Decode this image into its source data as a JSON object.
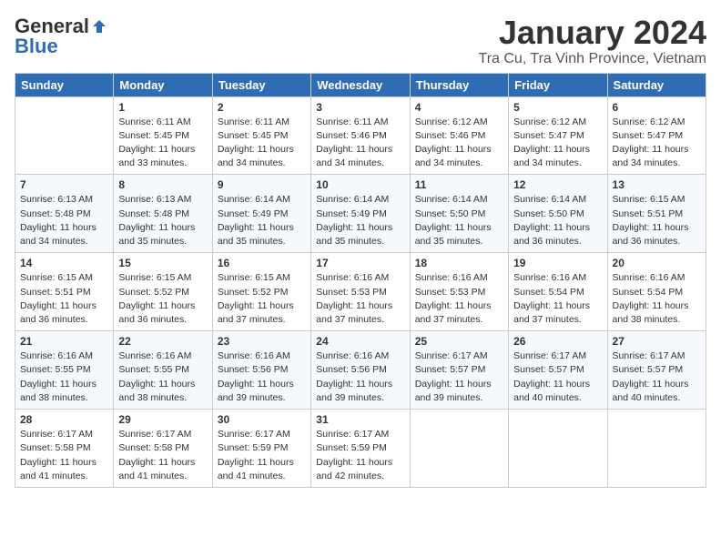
{
  "header": {
    "logo_general": "General",
    "logo_blue": "Blue",
    "title": "January 2024",
    "subtitle": "Tra Cu, Tra Vinh Province, Vietnam"
  },
  "days_of_week": [
    "Sunday",
    "Monday",
    "Tuesday",
    "Wednesday",
    "Thursday",
    "Friday",
    "Saturday"
  ],
  "weeks": [
    [
      {
        "day": "",
        "sunrise": "",
        "sunset": "",
        "daylight": ""
      },
      {
        "day": "1",
        "sunrise": "6:11 AM",
        "sunset": "5:45 PM",
        "daylight": "11 hours and 33 minutes."
      },
      {
        "day": "2",
        "sunrise": "6:11 AM",
        "sunset": "5:45 PM",
        "daylight": "11 hours and 34 minutes."
      },
      {
        "day": "3",
        "sunrise": "6:11 AM",
        "sunset": "5:46 PM",
        "daylight": "11 hours and 34 minutes."
      },
      {
        "day": "4",
        "sunrise": "6:12 AM",
        "sunset": "5:46 PM",
        "daylight": "11 hours and 34 minutes."
      },
      {
        "day": "5",
        "sunrise": "6:12 AM",
        "sunset": "5:47 PM",
        "daylight": "11 hours and 34 minutes."
      },
      {
        "day": "6",
        "sunrise": "6:12 AM",
        "sunset": "5:47 PM",
        "daylight": "11 hours and 34 minutes."
      }
    ],
    [
      {
        "day": "7",
        "sunrise": "6:13 AM",
        "sunset": "5:48 PM",
        "daylight": "11 hours and 34 minutes."
      },
      {
        "day": "8",
        "sunrise": "6:13 AM",
        "sunset": "5:48 PM",
        "daylight": "11 hours and 35 minutes."
      },
      {
        "day": "9",
        "sunrise": "6:14 AM",
        "sunset": "5:49 PM",
        "daylight": "11 hours and 35 minutes."
      },
      {
        "day": "10",
        "sunrise": "6:14 AM",
        "sunset": "5:49 PM",
        "daylight": "11 hours and 35 minutes."
      },
      {
        "day": "11",
        "sunrise": "6:14 AM",
        "sunset": "5:50 PM",
        "daylight": "11 hours and 35 minutes."
      },
      {
        "day": "12",
        "sunrise": "6:14 AM",
        "sunset": "5:50 PM",
        "daylight": "11 hours and 36 minutes."
      },
      {
        "day": "13",
        "sunrise": "6:15 AM",
        "sunset": "5:51 PM",
        "daylight": "11 hours and 36 minutes."
      }
    ],
    [
      {
        "day": "14",
        "sunrise": "6:15 AM",
        "sunset": "5:51 PM",
        "daylight": "11 hours and 36 minutes."
      },
      {
        "day": "15",
        "sunrise": "6:15 AM",
        "sunset": "5:52 PM",
        "daylight": "11 hours and 36 minutes."
      },
      {
        "day": "16",
        "sunrise": "6:15 AM",
        "sunset": "5:52 PM",
        "daylight": "11 hours and 37 minutes."
      },
      {
        "day": "17",
        "sunrise": "6:16 AM",
        "sunset": "5:53 PM",
        "daylight": "11 hours and 37 minutes."
      },
      {
        "day": "18",
        "sunrise": "6:16 AM",
        "sunset": "5:53 PM",
        "daylight": "11 hours and 37 minutes."
      },
      {
        "day": "19",
        "sunrise": "6:16 AM",
        "sunset": "5:54 PM",
        "daylight": "11 hours and 37 minutes."
      },
      {
        "day": "20",
        "sunrise": "6:16 AM",
        "sunset": "5:54 PM",
        "daylight": "11 hours and 38 minutes."
      }
    ],
    [
      {
        "day": "21",
        "sunrise": "6:16 AM",
        "sunset": "5:55 PM",
        "daylight": "11 hours and 38 minutes."
      },
      {
        "day": "22",
        "sunrise": "6:16 AM",
        "sunset": "5:55 PM",
        "daylight": "11 hours and 38 minutes."
      },
      {
        "day": "23",
        "sunrise": "6:16 AM",
        "sunset": "5:56 PM",
        "daylight": "11 hours and 39 minutes."
      },
      {
        "day": "24",
        "sunrise": "6:16 AM",
        "sunset": "5:56 PM",
        "daylight": "11 hours and 39 minutes."
      },
      {
        "day": "25",
        "sunrise": "6:17 AM",
        "sunset": "5:57 PM",
        "daylight": "11 hours and 39 minutes."
      },
      {
        "day": "26",
        "sunrise": "6:17 AM",
        "sunset": "5:57 PM",
        "daylight": "11 hours and 40 minutes."
      },
      {
        "day": "27",
        "sunrise": "6:17 AM",
        "sunset": "5:57 PM",
        "daylight": "11 hours and 40 minutes."
      }
    ],
    [
      {
        "day": "28",
        "sunrise": "6:17 AM",
        "sunset": "5:58 PM",
        "daylight": "11 hours and 41 minutes."
      },
      {
        "day": "29",
        "sunrise": "6:17 AM",
        "sunset": "5:58 PM",
        "daylight": "11 hours and 41 minutes."
      },
      {
        "day": "30",
        "sunrise": "6:17 AM",
        "sunset": "5:59 PM",
        "daylight": "11 hours and 41 minutes."
      },
      {
        "day": "31",
        "sunrise": "6:17 AM",
        "sunset": "5:59 PM",
        "daylight": "11 hours and 42 minutes."
      },
      {
        "day": "",
        "sunrise": "",
        "sunset": "",
        "daylight": ""
      },
      {
        "day": "",
        "sunrise": "",
        "sunset": "",
        "daylight": ""
      },
      {
        "day": "",
        "sunrise": "",
        "sunset": "",
        "daylight": ""
      }
    ]
  ],
  "labels": {
    "sunrise": "Sunrise:",
    "sunset": "Sunset:",
    "daylight": "Daylight:"
  }
}
